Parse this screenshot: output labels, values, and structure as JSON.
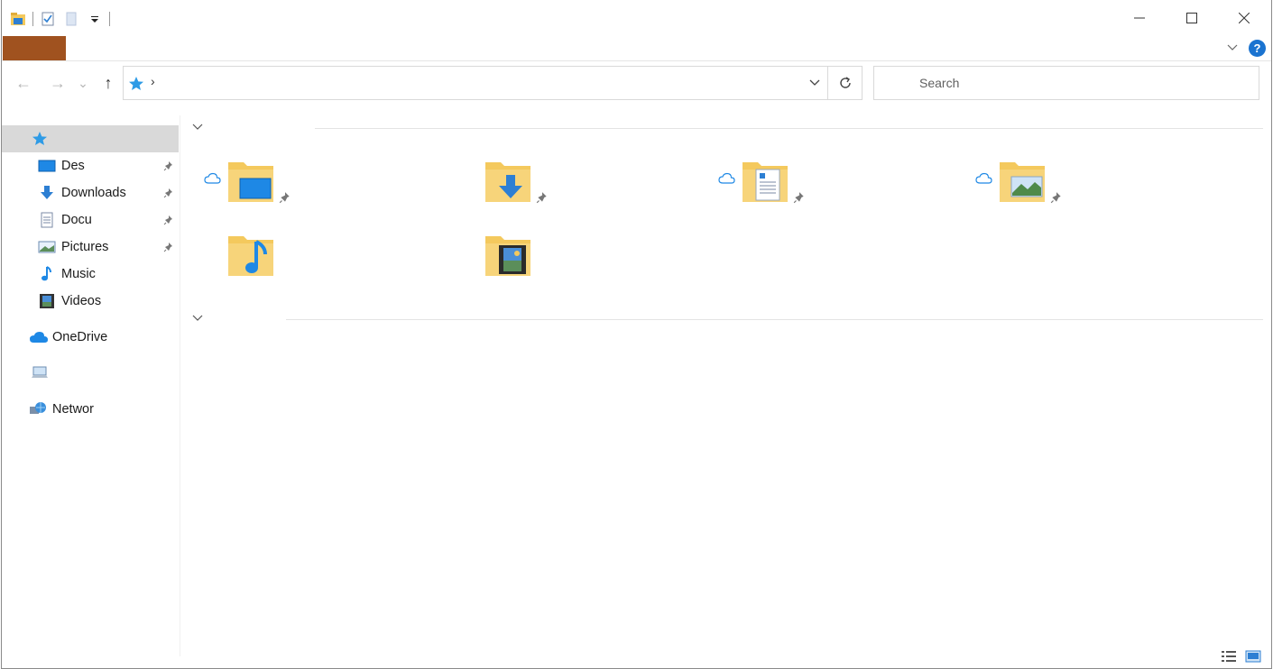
{
  "title_bar": {
    "quick_access_toolbar": [
      "folder-icon",
      "properties-icon",
      "new-folder-icon",
      "customize-dropdown-icon"
    ],
    "window_controls": [
      "minimize-icon",
      "maximize-icon",
      "close-icon"
    ]
  },
  "ribbon": {
    "file_tab_color": "#a0521f",
    "help_label": "?"
  },
  "navigation": {
    "back": "←",
    "forward": "→",
    "recent": "⌄",
    "up": "↑",
    "breadcrumb_separator": "›",
    "refresh": "↻"
  },
  "search": {
    "placeholder": "Search",
    "value": ""
  },
  "sidebar": {
    "quick_access_selected": true,
    "items": [
      {
        "label": "Des",
        "icon": "desktop-icon",
        "pinned": true
      },
      {
        "label": "Downloads",
        "icon": "downloads-icon",
        "pinned": true
      },
      {
        "label": "Docu",
        "icon": "documents-icon",
        "pinned": true
      },
      {
        "label": "Pictures",
        "icon": "pictures-icon",
        "pinned": true
      },
      {
        "label": "Music",
        "icon": "music-icon",
        "pinned": false
      },
      {
        "label": "Videos",
        "icon": "videos-icon",
        "pinned": false
      }
    ],
    "onedrive": {
      "label": "OneDrive",
      "icon": "onedrive-icon"
    },
    "this_pc": {
      "label": "",
      "icon": "this-pc-icon"
    },
    "network": {
      "label": "Networ",
      "icon": "network-icon"
    }
  },
  "content": {
    "groups": [
      {
        "tiles": [
          {
            "icon": "desktop-folder-icon",
            "cloud": true,
            "pinned": true
          },
          {
            "icon": "downloads-folder-icon",
            "cloud": false,
            "pinned": true
          },
          {
            "icon": "documents-folder-icon",
            "cloud": true,
            "pinned": true
          },
          {
            "icon": "pictures-folder-icon",
            "cloud": true,
            "pinned": true
          },
          {
            "icon": "music-folder-icon",
            "cloud": false,
            "pinned": false
          },
          {
            "icon": "videos-folder-icon",
            "cloud": false,
            "pinned": false
          }
        ]
      },
      {
        "tiles": []
      }
    ]
  },
  "status_bar": {
    "view_buttons": [
      "details-view-icon",
      "large-icons-view-icon"
    ]
  },
  "colors": {
    "accent": "#1a73d0",
    "folder": "#f4c95d",
    "selection": "#d9d9d9"
  }
}
